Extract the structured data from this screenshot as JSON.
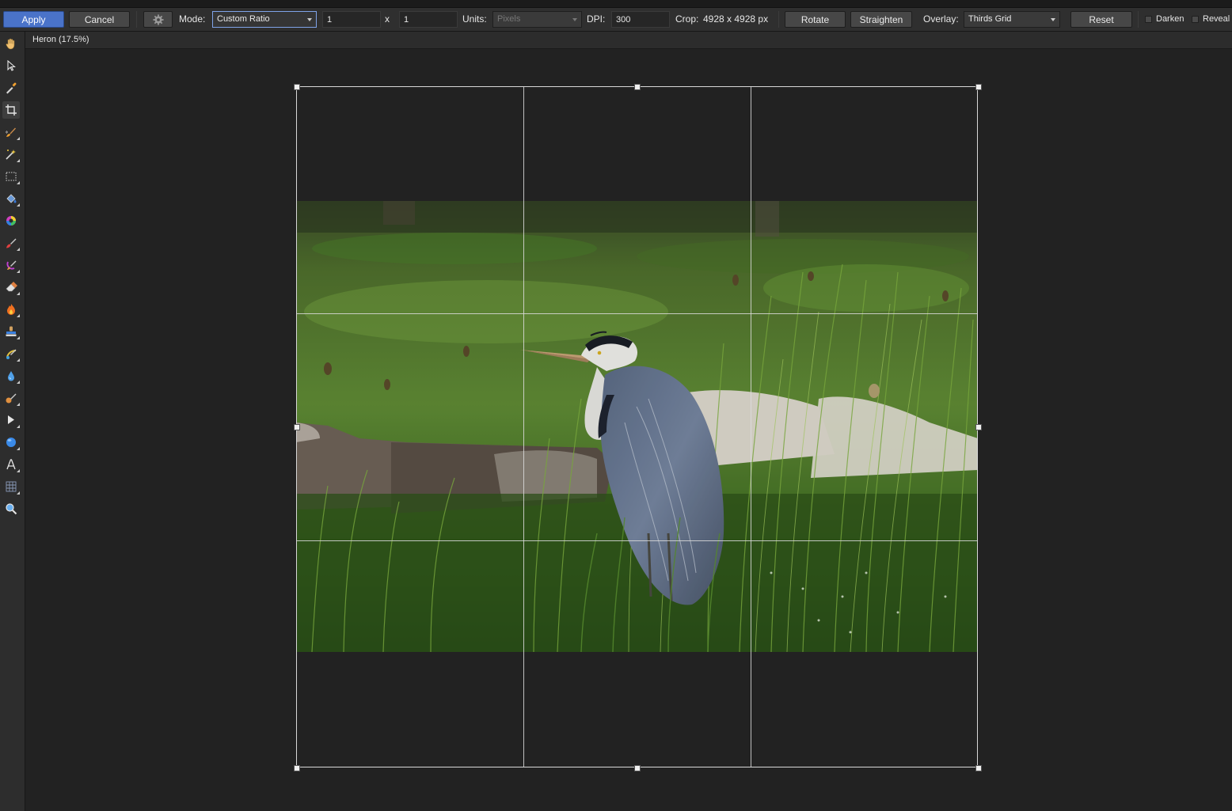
{
  "toolbar": {
    "apply_label": "Apply",
    "cancel_label": "Cancel",
    "mode_label": "Mode:",
    "mode_value": "Custom Ratio",
    "ratio_width": "1",
    "ratio_sep": "x",
    "ratio_height": "1",
    "units_label": "Units:",
    "units_value": "Pixels",
    "dpi_label": "DPI:",
    "dpi_value": "300",
    "crop_label": "Crop:",
    "crop_value": "4928 x 4928 px",
    "rotate_label": "Rotate",
    "straighten_label": "Straighten",
    "overlay_label": "Overlay:",
    "overlay_value": "Thirds Grid",
    "reset_label": "Reset",
    "darken_label": "Darken",
    "reveal_label": "Reveal"
  },
  "document": {
    "tab_title": "Heron (17.5%)"
  },
  "tools": [
    {
      "icon": "hand-icon"
    },
    {
      "icon": "pointer-icon"
    },
    {
      "icon": "color-picker-icon"
    },
    {
      "icon": "crop-icon"
    },
    {
      "icon": "selection-brush-icon"
    },
    {
      "icon": "magic-wand-icon"
    },
    {
      "icon": "marquee-icon"
    },
    {
      "icon": "flood-fill-icon"
    },
    {
      "icon": "color-wheel-icon"
    },
    {
      "icon": "paint-brush-icon"
    },
    {
      "icon": "pixel-brush-icon"
    },
    {
      "icon": "eraser-icon"
    },
    {
      "icon": "burn-icon"
    },
    {
      "icon": "clone-stamp-icon"
    },
    {
      "icon": "healing-brush-icon"
    },
    {
      "icon": "blur-icon"
    },
    {
      "icon": "smudge-icon"
    },
    {
      "icon": "node-icon"
    },
    {
      "icon": "shape-icon"
    },
    {
      "icon": "text-icon"
    },
    {
      "icon": "mesh-warp-icon"
    },
    {
      "icon": "zoom-icon"
    }
  ],
  "colors": {
    "accent": "#4a73c9",
    "grass": "#3f6a25",
    "heron_body": "#6a7890"
  }
}
